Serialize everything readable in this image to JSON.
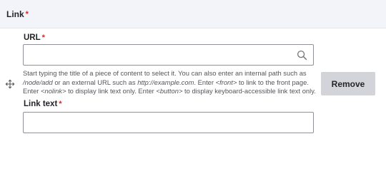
{
  "section": {
    "title": "Link",
    "required_marker": "*"
  },
  "url_field": {
    "label": "URL",
    "required_marker": "*",
    "value": "",
    "placeholder": "",
    "icon": "search-icon"
  },
  "description": {
    "line1": "Start typing the title of a piece of content to select it. You can also enter an internal path such as",
    "line2_em1": "/node/add",
    "line2_text1": " or an external URL such as ",
    "line2_em2": "http://example.com",
    "line2_text2": ". Enter ",
    "line2_em3": "<front>",
    "line2_text3": " to link to the front page.",
    "line3_text1": "Enter ",
    "line3_em1": "<nolink>",
    "line3_text2": " to display link text only. Enter ",
    "line3_em2": "<button>",
    "line3_text3": " to display keyboard-accessible link text only."
  },
  "drag_handle": {
    "icon": "move-icon"
  },
  "remove_button": {
    "label": "Remove"
  },
  "link_text_field": {
    "label": "Link text",
    "required_marker": "*",
    "value": "",
    "placeholder": ""
  },
  "colors": {
    "required": "#dc2323",
    "header_bg": "#f3f4f9",
    "button_bg": "#d3d4d9",
    "border": "#919297"
  }
}
